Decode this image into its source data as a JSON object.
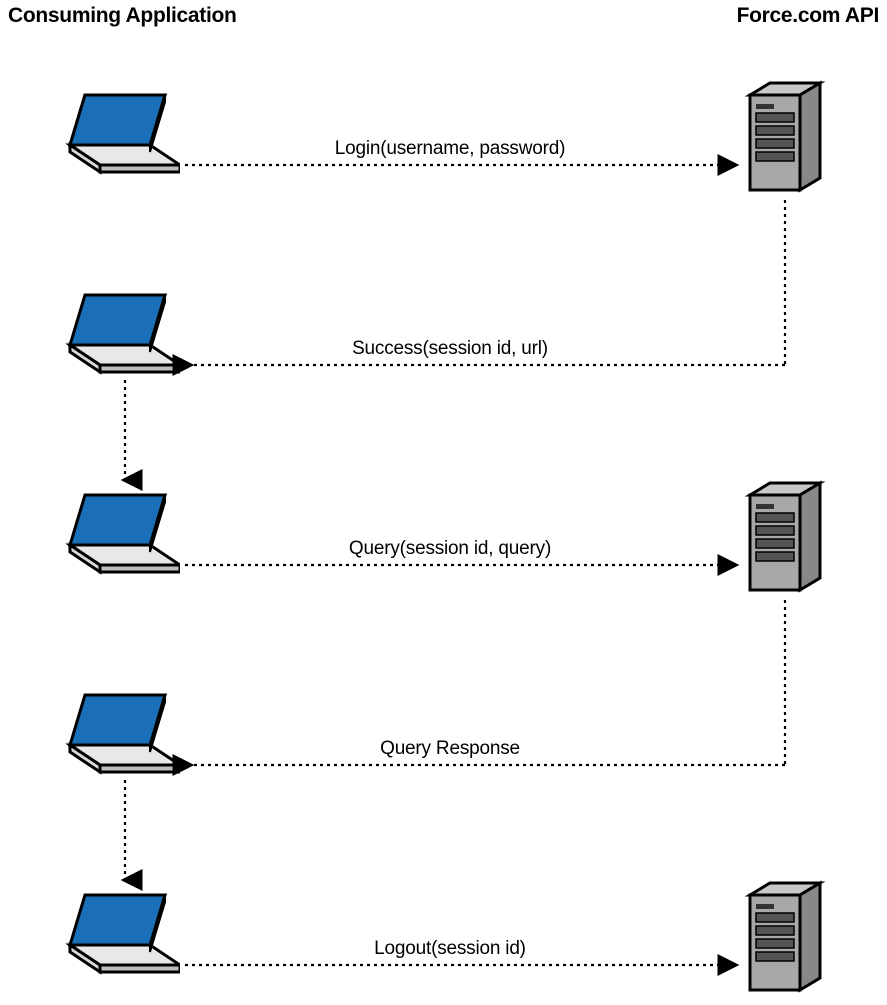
{
  "headers": {
    "left": "Consuming Application",
    "right": "Force.com API"
  },
  "messages": {
    "step1": "Login(username, password)",
    "step2": "Success(session id, url)",
    "step3": "Query(session id, query)",
    "step4": "Query Response",
    "step5": "Logout(session id)"
  }
}
